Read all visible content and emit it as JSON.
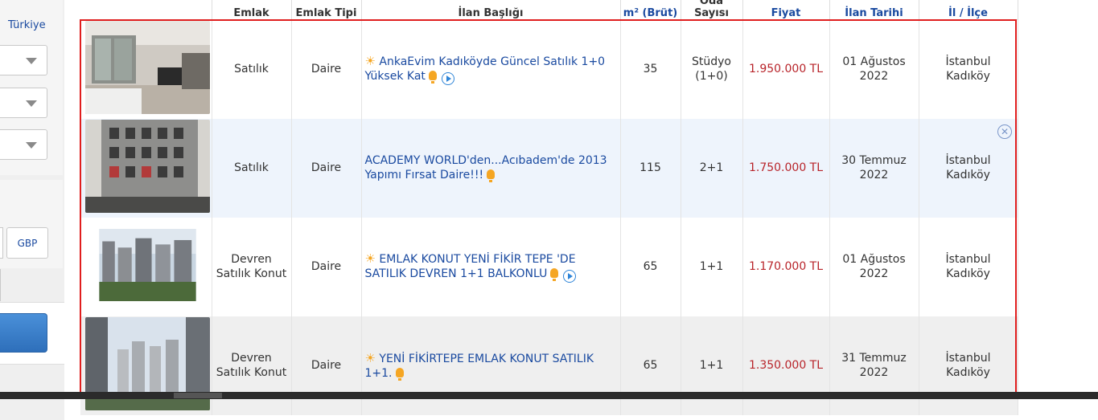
{
  "sidebar": {
    "country_link": "Türkiye",
    "currency_gbp": "GBP"
  },
  "table": {
    "headers": {
      "emlak": "Emlak",
      "emlak_tipi": "Emlak Tipi",
      "ilan_basligi": "İlan Başlığı",
      "m2": "m² (Brüt)",
      "oda_sayisi": "Oda Sayısı",
      "fiyat": "Fiyat",
      "ilan_tarihi": "İlan Tarihi",
      "il_ilce": "İl / İlçe"
    },
    "rows": [
      {
        "emlak": "Satılık",
        "tip": "Daire",
        "title": "AnkaEvim Kadıköyde Güncel Satılık 1+0 Yüksek Kat",
        "m2": "35",
        "oda": "Stüdyo (1+0)",
        "fiyat": "1.950.000 TL",
        "tarih": "01 Ağustos 2022",
        "konum": "İstanbul Kadıköy"
      },
      {
        "emlak": "Satılık",
        "tip": "Daire",
        "title": "ACADEMY WORLD'den...Acıbadem'de 2013 Yapımı Fırsat Daire!!!",
        "m2": "115",
        "oda": "2+1",
        "fiyat": "1.750.000 TL",
        "tarih": "30 Temmuz 2022",
        "konum": "İstanbul Kadıköy"
      },
      {
        "emlak": "Devren Satılık Konut",
        "tip": "Daire",
        "title": "EMLAK KONUT YENİ FİKİR TEPE 'DE SATILIK DEVREN 1+1 BALKONLU",
        "m2": "65",
        "oda": "1+1",
        "fiyat": "1.170.000 TL",
        "tarih": "01 Ağustos 2022",
        "konum": "İstanbul Kadıköy"
      },
      {
        "emlak": "Devren Satılık Konut",
        "tip": "Daire",
        "title": "YENİ FİKİRTEPE EMLAK KONUT SATILIK 1+1.",
        "m2": "65",
        "oda": "1+1",
        "fiyat": "1.350.000 TL",
        "tarih": "31 Temmuz 2022",
        "konum": "İstanbul Kadıköy"
      }
    ]
  },
  "colors": {
    "link_blue": "#1a4aa0",
    "price_red": "#b8242a",
    "highlight_red": "#e01e1e",
    "row_blue": "#eef4fc",
    "row_gray": "#efefef"
  }
}
